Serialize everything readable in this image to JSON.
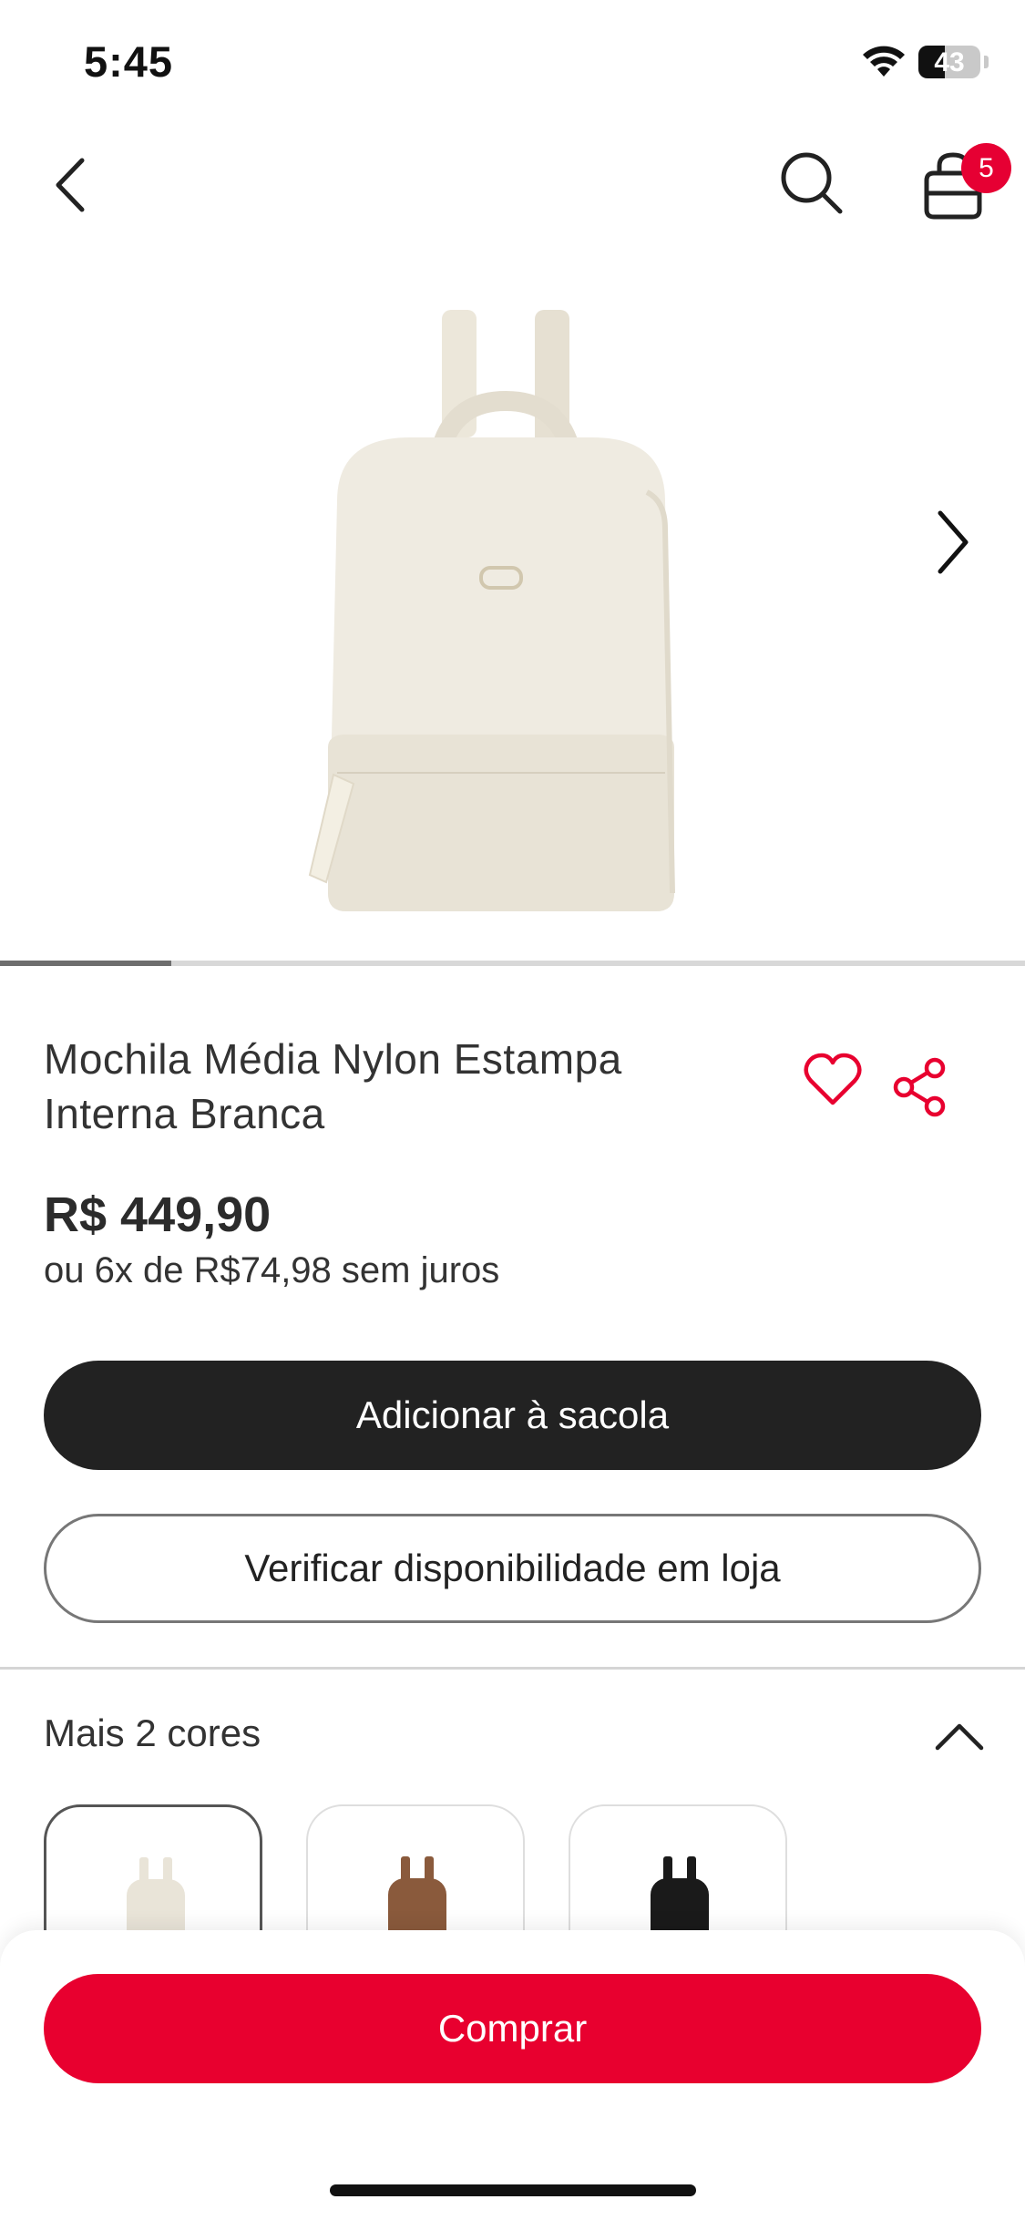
{
  "status_bar": {
    "time": "5:45",
    "battery": "43",
    "battery_level": 0.43
  },
  "header": {
    "cart_count": "5",
    "icons": [
      "chevron-left-icon",
      "search-icon",
      "shopping-bag-icon"
    ]
  },
  "gallery": {
    "image_index": 1,
    "image_count": 6,
    "progress": 0.167,
    "next_icon": "chevron-right-icon"
  },
  "product": {
    "title": "Mochila Média Nylon Estampa Interna Branca",
    "price": "R$ 449,90",
    "installments": "ou 6x de R$74,98 sem juros"
  },
  "actions": {
    "add_to_bag": "Adicionar à sacola",
    "check_store": "Verificar disponibilidade em loja",
    "buy": "Comprar"
  },
  "colors": {
    "title": "Mais 2 cores",
    "swatches": [
      {
        "color": "#e9e4d8",
        "selected": true
      },
      {
        "color": "#8a5a3c",
        "selected": false
      },
      {
        "color": "#1a1a1a",
        "selected": false
      }
    ]
  },
  "theme": {
    "accent": "#e8002f",
    "dark_button": "#222222",
    "badge": "#e60033"
  }
}
